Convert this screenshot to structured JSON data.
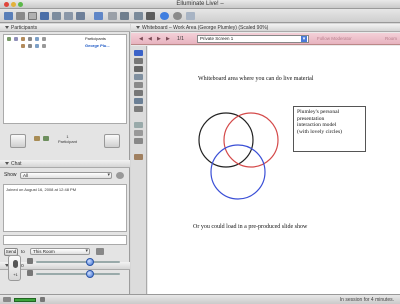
{
  "window": {
    "title": "Elluminate Live! –"
  },
  "toolbar": {
    "icons": [
      "save-icon",
      "list-icon",
      "grid-icon",
      "layout-icon",
      "whiteboard-icon",
      "screen-icon",
      "web-icon",
      "app-share-icon",
      "globe-icon",
      "gear-icon",
      "theme-icon"
    ]
  },
  "participants": {
    "header": "Participants",
    "rows": [
      {
        "name": "Participants",
        "selected": false
      },
      {
        "name": "George Plu...",
        "selected": true
      }
    ],
    "count_number": "1",
    "count_label": "Participant"
  },
  "chat": {
    "header": "Chat",
    "show_label": "Show",
    "show_value": "All",
    "log": "Joined on August 16, 2008 at 12:48 PM",
    "send_label": "Send",
    "to_label": "to",
    "to_value": "This Room"
  },
  "audio": {
    "header": "Audio",
    "mic_count": "+1"
  },
  "whiteboard": {
    "header": "Whiteboard – Work Area (George Plumley) (Scaled 90%)",
    "page": "1/1",
    "screen": "Private Screen 1",
    "follow_moderator": "Follow Moderator",
    "room": "Room",
    "top_text": "Whiteboard area where you can do live material",
    "note_lines": [
      "Plumley's personal",
      "presentation",
      "interaction model",
      "(with lovely circles)"
    ],
    "bottom_text": "Or you could load in a pre-produced slide show",
    "colors": {
      "black": "#222222",
      "red": "#d44a4a",
      "blue": "#3a4fd6"
    }
  },
  "status": {
    "text": "In session for 4 minutes."
  }
}
